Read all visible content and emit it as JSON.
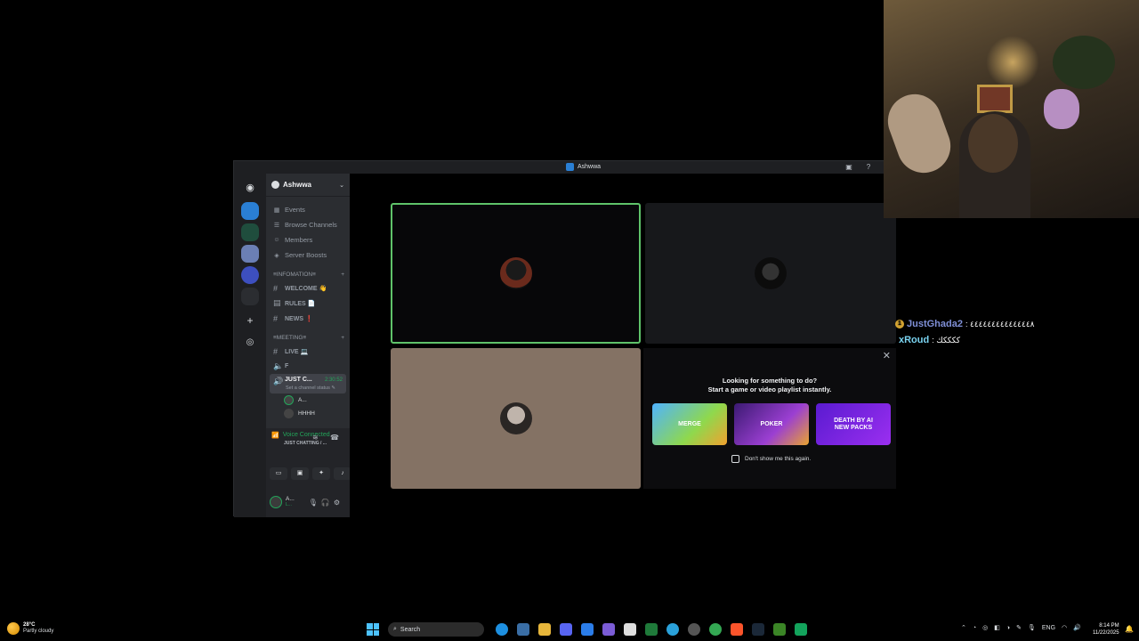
{
  "window": {
    "title": "Ashwwa"
  },
  "server": {
    "name": "Ashwwa",
    "menu": [
      "Events",
      "Browse Channels",
      "Members",
      "Server Boosts"
    ],
    "categories": [
      {
        "label": "≡INFOMATION≡",
        "channels": [
          "WELCOME 👋",
          "RULES 📄",
          "NEWS ❗"
        ]
      },
      {
        "label": "≡MEETING≡",
        "channels": [
          "LIVE 💻",
          "F"
        ]
      }
    ],
    "active_voice": {
      "name": "JUST C...",
      "timer": "2:30:52",
      "status_placeholder": "Set a channel status ✎",
      "users": [
        "A...",
        "HHHH"
      ]
    }
  },
  "voice_panel": {
    "status": "Voice Connected",
    "sub": "JUST CHATTING / ..."
  },
  "user_panel": {
    "name": "A...",
    "sub": "L..."
  },
  "activity": {
    "line1": "Looking for something to do?",
    "line2": "Start a game or video playlist instantly.",
    "games": [
      {
        "label": "MERGE"
      },
      {
        "label": "POKER"
      },
      {
        "label": "DEATH BY AI\nNEW PACKS"
      }
    ],
    "checkbox_label": "Don't show me this again."
  },
  "chat": [
    {
      "user": "JustGhada2",
      "text": ": ٤٤٤٤٤٤٤٤٤٤٤٤٤٤٨"
    },
    {
      "user": "xRoud",
      "text": ": ككككك"
    }
  ],
  "taskbar": {
    "temp": "28°C",
    "condition": "Partly cloudy",
    "search": "Search",
    "lang": "ENG",
    "time": "8:14 PM",
    "date": "11/22/2025"
  }
}
